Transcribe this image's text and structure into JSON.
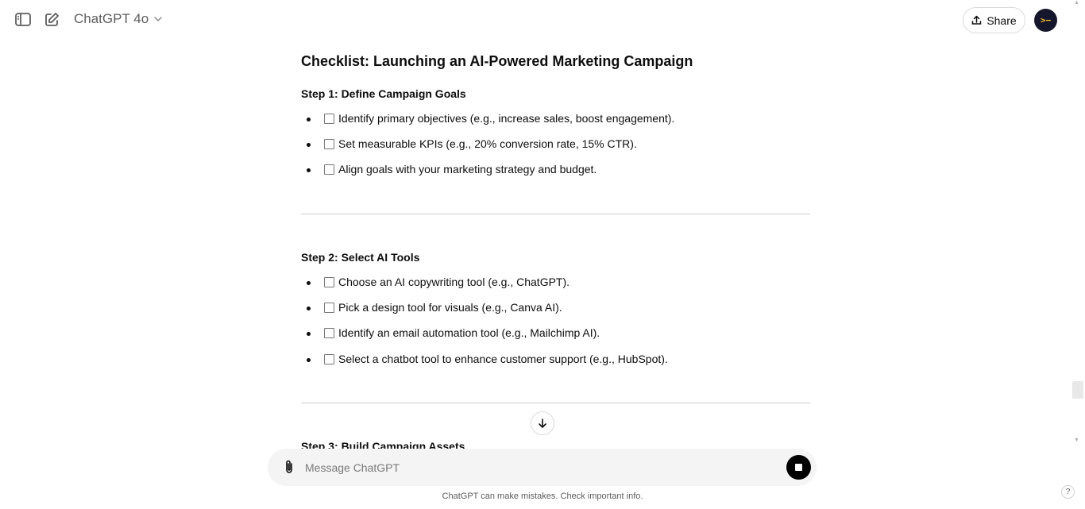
{
  "header": {
    "model_name": "ChatGPT 4o",
    "share_label": "Share",
    "avatar_text": ">−"
  },
  "checklist": {
    "title": "Checklist: Launching an AI-Powered Marketing Campaign",
    "steps": [
      {
        "heading": "Step 1: Define Campaign Goals",
        "items": [
          "Identify primary objectives (e.g., increase sales, boost engagement).",
          "Set measurable KPIs (e.g., 20% conversion rate, 15% CTR).",
          "Align goals with your marketing strategy and budget."
        ]
      },
      {
        "heading": "Step 2: Select AI Tools",
        "items": [
          "Choose an AI copywriting tool (e.g., ChatGPT).",
          "Pick a design tool for visuals (e.g., Canva AI).",
          "Identify an email automation tool (e.g., Mailchimp AI).",
          "Select a chatbot tool to enhance customer support (e.g., HubSpot)."
        ]
      },
      {
        "heading": "Step 3: Build Campaign Assets"
      }
    ]
  },
  "composer": {
    "placeholder": "Message ChatGPT"
  },
  "footer": {
    "disclaimer": "ChatGPT can make mistakes. Check important info.",
    "help_label": "?"
  },
  "icons": {
    "sidebar_toggle": "sidebar-icon",
    "new_chat": "compose-icon",
    "share": "upload-icon",
    "attach": "paperclip-icon",
    "stop": "stop-icon",
    "scroll_down": "arrow-down-icon"
  },
  "colors": {
    "text": "#0d0d0d",
    "muted": "#5d5d5d",
    "composer_bg": "#f4f4f4",
    "avatar_bg": "#15152b"
  }
}
